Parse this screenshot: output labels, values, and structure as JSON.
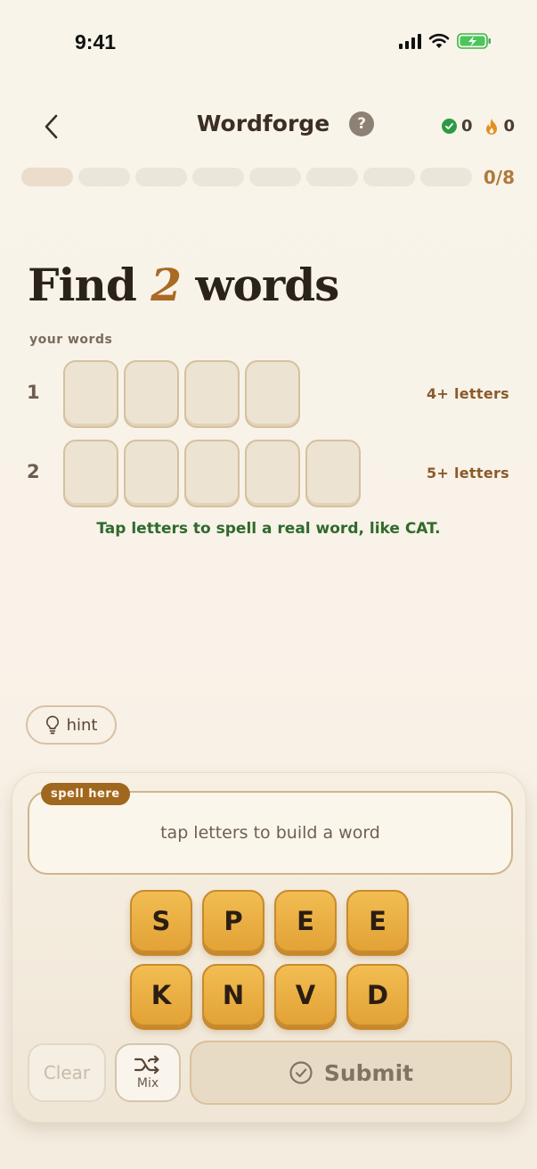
{
  "status_bar": {
    "time": "9:41"
  },
  "header": {
    "title": "Wordforge",
    "help": "?",
    "correct_count": "0",
    "streak_count": "0"
  },
  "progress": {
    "label": "0/8",
    "total": 8,
    "completed": 0
  },
  "main": {
    "heading_prefix": "Find",
    "heading_number": "2",
    "heading_suffix": "words",
    "your_words_label": "your words",
    "rows": [
      {
        "number": "1",
        "slots": 4,
        "requirement": "4+ letters"
      },
      {
        "number": "2",
        "slots": 5,
        "requirement": "5+ letters"
      }
    ],
    "instruction": "Tap letters to spell a real word, like CAT."
  },
  "hint": {
    "label": "hint"
  },
  "panel": {
    "spell_tag": "spell here",
    "placeholder": "tap letters to build a word",
    "letters": [
      "S",
      "P",
      "E",
      "E",
      "K",
      "N",
      "V",
      "D"
    ],
    "clear_label": "Clear",
    "mix_label": "Mix",
    "submit_label": "Submit"
  },
  "colors": {
    "accent": "#a86a24",
    "tile": "#e9ad40",
    "success": "#2d9a46",
    "instruction": "#2f6a2c"
  }
}
